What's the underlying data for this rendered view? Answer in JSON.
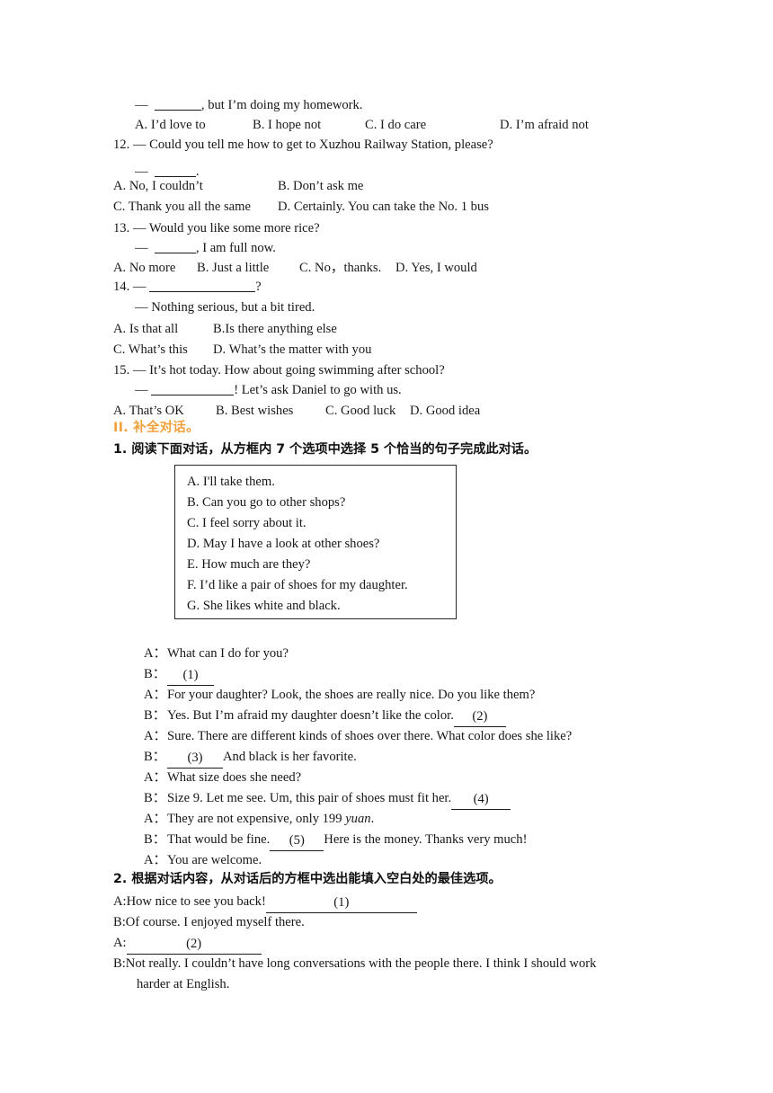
{
  "colors": {
    "text": "#161616",
    "accent_orange": "#F2A13C",
    "box_border": "#262626"
  },
  "questions": [
    {
      "id": "q11-answer-line",
      "stem": "—  ______, but I’m doing my homework.",
      "stem_prefix": "—  ",
      "stem_suffix": ", but I’m doing my homework.",
      "options_inline": [
        "A. I’d love to",
        "B. I hope not",
        "C. I do care",
        "D. I’m afraid not"
      ]
    },
    {
      "id": "q12",
      "number": "12.",
      "stem": "12. — Could you tell me how to get to Xuzhou Railway Station, please?",
      "reply_prefix": "—  ",
      "reply_suffix": ".",
      "options": [
        "A. No, I couldn’t",
        "B. Don’t ask me",
        "C. Thank you all the same",
        "D. Certainly. You can take the No. 1 bus"
      ]
    },
    {
      "id": "q13",
      "number": "13.",
      "stem": "13. — Would you like some more rice?",
      "reply_prefix": "—  ",
      "reply_suffix": ", I am full now.",
      "options": [
        "A. No more",
        "B. Just a little",
        "C. No，thanks.",
        "D. Yes, I would"
      ]
    },
    {
      "id": "q14",
      "number": "14.",
      "stem_prefix": "14. — ",
      "stem_suffix": "?",
      "reply": "— Nothing serious, but a bit tired.",
      "options": [
        "A. Is that all",
        "B.Is there anything else",
        "C. What’s this",
        "D. What’s the matter with you"
      ]
    },
    {
      "id": "q15",
      "number": "15.",
      "stem": "15. — It’s hot today. How about going swimming after school?",
      "reply_prefix": "— ",
      "reply_suffix": "! Let’s ask Daniel to go with us.",
      "options": [
        "A. That’s OK",
        "B. Best wishes",
        "C. Good luck",
        "D. Good idea"
      ]
    }
  ],
  "section": {
    "heading": "II. 补全对话。",
    "task1_heading": "1. 阅读下面对话，从方框内 7 个选项中选择 5 个恰当的句子完成此对话。",
    "task2_heading": "2. 根据对话内容，从对话后的方框中选出能填入空白处的最佳选项。"
  },
  "option_box": {
    "items": [
      "A. I'll take them.",
      "B. Can you go to other shops?",
      "C. I feel sorry about it.",
      "D. May I have a look at other shoes?",
      "E. How much are they?",
      "F. I’d like a pair of shoes for my daughter.",
      "G. She likes white and black."
    ]
  },
  "dialogue1": {
    "lines": [
      {
        "speaker": "A：",
        "text": "What can I do for you?",
        "blank": null
      },
      {
        "speaker": "B：",
        "text": "",
        "blank": "(1)",
        "blank_first": true
      },
      {
        "speaker": "A：",
        "text": "For your daughter? Look, the shoes are really nice. Do you like them?",
        "blank": null
      },
      {
        "speaker": "B：",
        "text": "Yes. But I’m afraid my daughter doesn’t like the color.",
        "blank": "(2)"
      },
      {
        "speaker": "A：",
        "text": "Sure. There are different kinds of shoes over there. What color does she like?",
        "blank": null
      },
      {
        "speaker": "B：",
        "text": "And black is her favorite.",
        "blank": "(3)",
        "blank_first": true
      },
      {
        "speaker": "A：",
        "text": "What size does she need?",
        "blank": null
      },
      {
        "speaker": "B：",
        "text": "Size 9. Let me see. Um, this pair of shoes must fit her.",
        "blank": "(4)"
      },
      {
        "speaker": "A：",
        "text": "They are not expensive, only 199 ",
        "italic_tail": "yuan",
        "tail": ".",
        "blank": null
      },
      {
        "speaker": "B：",
        "text": "That would be fine.",
        "blank": "(5)",
        "tail_after_blank": "Here is the money. Thanks very much!"
      },
      {
        "speaker": "A：",
        "text": "You are welcome.",
        "blank": null
      }
    ]
  },
  "dialogue2": {
    "lines": [
      {
        "speaker": "A:",
        "text": "How nice to see you back!",
        "blank": "(1)"
      },
      {
        "speaker": "B:",
        "text": "Of course. I enjoyed myself there.",
        "blank": null
      },
      {
        "speaker": "A:",
        "text": "",
        "blank": "(2)",
        "blank_first": true
      },
      {
        "speaker": "B:",
        "text": "Not really. I couldn’t have long conversations with the people there. I think I should work",
        "blank": null,
        "wrap": "harder at English."
      }
    ]
  }
}
